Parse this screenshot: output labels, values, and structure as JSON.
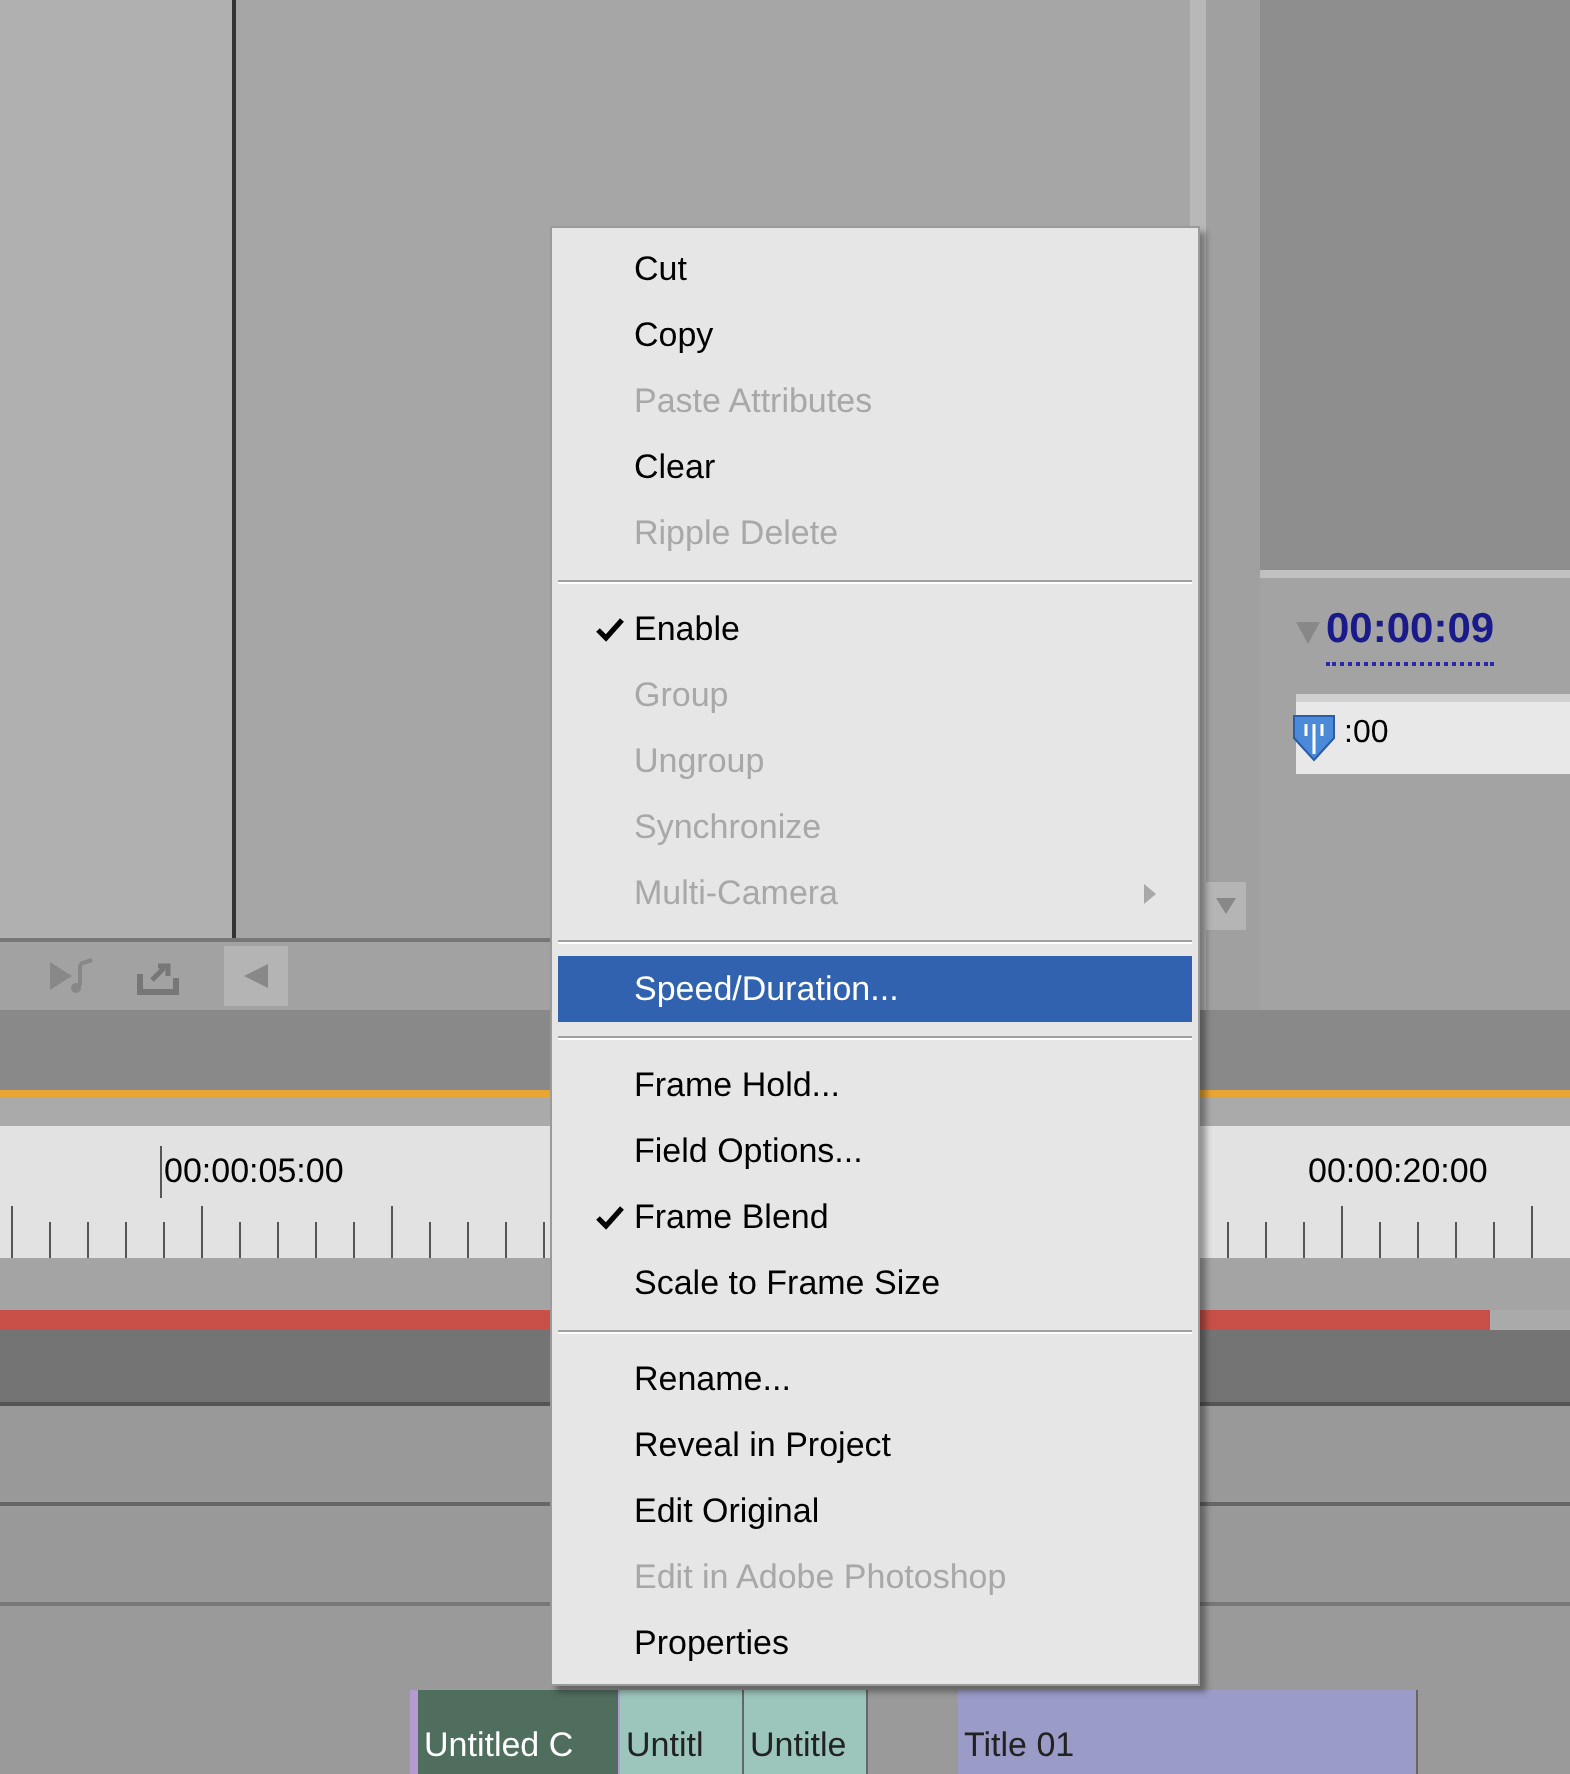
{
  "program_monitor": {
    "timecode": "00:00:09",
    "mini_ruler_label": ":00"
  },
  "timeline": {
    "ruler_labels": [
      "00:00:05:00",
      "00:00:20:00"
    ],
    "clips": [
      {
        "label": "Untitled C",
        "kind": "video"
      },
      {
        "label": "Untitl",
        "kind": "video-light"
      },
      {
        "label": "Untitle",
        "kind": "video-light"
      },
      {
        "label": "Title 01",
        "kind": "title"
      }
    ]
  },
  "context_menu": {
    "items": [
      {
        "kind": "item",
        "label": "Cut",
        "disabled": false,
        "checked": false,
        "selected": false,
        "submenu": false
      },
      {
        "kind": "item",
        "label": "Copy",
        "disabled": false,
        "checked": false,
        "selected": false,
        "submenu": false
      },
      {
        "kind": "item",
        "label": "Paste Attributes",
        "disabled": true,
        "checked": false,
        "selected": false,
        "submenu": false
      },
      {
        "kind": "item",
        "label": "Clear",
        "disabled": false,
        "checked": false,
        "selected": false,
        "submenu": false
      },
      {
        "kind": "item",
        "label": "Ripple Delete",
        "disabled": true,
        "checked": false,
        "selected": false,
        "submenu": false
      },
      {
        "kind": "separator"
      },
      {
        "kind": "item",
        "label": "Enable",
        "disabled": false,
        "checked": true,
        "selected": false,
        "submenu": false
      },
      {
        "kind": "item",
        "label": "Group",
        "disabled": true,
        "checked": false,
        "selected": false,
        "submenu": false
      },
      {
        "kind": "item",
        "label": "Ungroup",
        "disabled": true,
        "checked": false,
        "selected": false,
        "submenu": false
      },
      {
        "kind": "item",
        "label": "Synchronize",
        "disabled": true,
        "checked": false,
        "selected": false,
        "submenu": false
      },
      {
        "kind": "item",
        "label": "Multi-Camera",
        "disabled": true,
        "checked": false,
        "selected": false,
        "submenu": true
      },
      {
        "kind": "separator"
      },
      {
        "kind": "item",
        "label": "Speed/Duration...",
        "disabled": false,
        "checked": false,
        "selected": true,
        "submenu": false
      },
      {
        "kind": "separator"
      },
      {
        "kind": "item",
        "label": "Frame Hold...",
        "disabled": false,
        "checked": false,
        "selected": false,
        "submenu": false
      },
      {
        "kind": "item",
        "label": "Field Options...",
        "disabled": false,
        "checked": false,
        "selected": false,
        "submenu": false
      },
      {
        "kind": "item",
        "label": "Frame Blend",
        "disabled": false,
        "checked": true,
        "selected": false,
        "submenu": false
      },
      {
        "kind": "item",
        "label": "Scale to Frame Size",
        "disabled": false,
        "checked": false,
        "selected": false,
        "submenu": false
      },
      {
        "kind": "separator"
      },
      {
        "kind": "item",
        "label": "Rename...",
        "disabled": false,
        "checked": false,
        "selected": false,
        "submenu": false
      },
      {
        "kind": "item",
        "label": "Reveal in Project",
        "disabled": false,
        "checked": false,
        "selected": false,
        "submenu": false
      },
      {
        "kind": "item",
        "label": "Edit Original",
        "disabled": false,
        "checked": false,
        "selected": false,
        "submenu": false
      },
      {
        "kind": "item",
        "label": "Edit in Adobe Photoshop",
        "disabled": true,
        "checked": false,
        "selected": false,
        "submenu": false
      },
      {
        "kind": "item",
        "label": "Properties",
        "disabled": false,
        "checked": false,
        "selected": false,
        "submenu": false
      }
    ]
  }
}
